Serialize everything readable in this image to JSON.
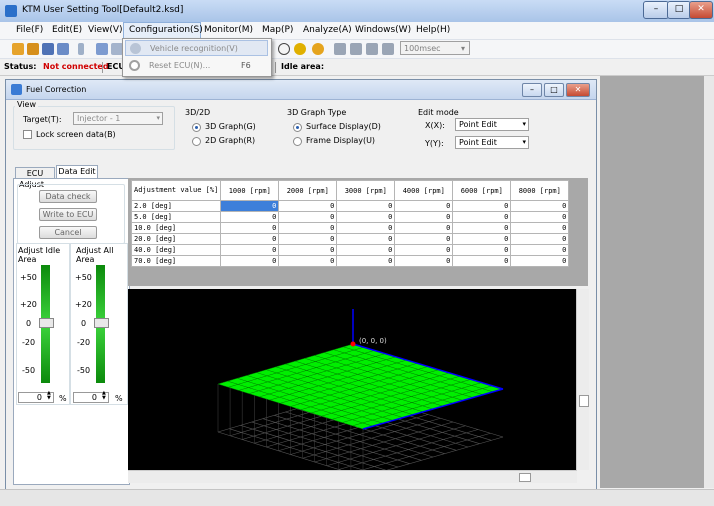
{
  "app": {
    "title": "KTM User Setting Tool[Default2.ksd]",
    "win_min": "–",
    "win_max": "□",
    "win_close": "✕"
  },
  "menu": {
    "file": "File(F)",
    "edit": "Edit(E)",
    "view": "View(V)",
    "configuration": "Configuration(S)",
    "monitor": "Monitor(M)",
    "map": "Map(P)",
    "analyze": "Analyze(A)",
    "windows": "Windows(W)",
    "help": "Help(H)"
  },
  "toolbar": {
    "interval": "100msec",
    "interval_arrow": "▾"
  },
  "dropdown": {
    "vehicle_recognition": "Vehicle recognition(V)",
    "reset_ecu": "Reset ECU(N)...",
    "reset_ecu_key": "F6"
  },
  "status": {
    "label": "Status:",
    "value": "Not connected",
    "ecu_prefix": "ECU",
    "idle_area": "Idle area:"
  },
  "fuel": {
    "title": "Fuel Correction",
    "view_group": "View",
    "target_label": "Target(T):",
    "target_value": "Injector - 1",
    "lock_label": "Lock screen data(B)",
    "group_3d2d": "3D/2D",
    "opt_3d": "3D Graph(G)",
    "opt_2d": "2D Graph(R)",
    "group_3dtype": "3D Graph Type",
    "opt_surface": "Surface Display(D)",
    "opt_frame": "Frame Display(U)",
    "group_edit": "Edit mode",
    "x_label": "X(X):",
    "x_value": "Point Edit",
    "y_label": "Y(Y):",
    "y_value": "Point Edit",
    "tab_ecu": "ECU Data",
    "tab_edit": "Data Edit",
    "adjust_group": "Adjust",
    "btn_check": "Data check",
    "btn_write": "Write to ECU",
    "btn_cancel": "Cancel",
    "adjust_idle": "Adjust Idle Area",
    "adjust_all": "Adjust All Area",
    "scale": [
      "+50",
      "+20",
      "0",
      "-20",
      "-50"
    ],
    "idle_value": "0",
    "all_value": "0",
    "unit": "%",
    "spin_up": "▲",
    "spin_down": "▼",
    "dropdown_arrow": "▾",
    "origin_label": "(0, 0, 0)"
  },
  "table": {
    "corner": "Adjustment value [%]",
    "columns": [
      "1000 [rpm]",
      "2000 [rpm]",
      "3000 [rpm]",
      "4000 [rpm]",
      "6000 [rpm]",
      "8000 [rpm]"
    ],
    "rows": [
      {
        "label": "2.0 [deg]",
        "values": [
          "0",
          "0",
          "0",
          "0",
          "0",
          "0"
        ]
      },
      {
        "label": "5.0 [deg]",
        "values": [
          "0",
          "0",
          "0",
          "0",
          "0",
          "0"
        ]
      },
      {
        "label": "10.0 [deg]",
        "values": [
          "0",
          "0",
          "0",
          "0",
          "0",
          "0"
        ]
      },
      {
        "label": "20.0 [deg]",
        "values": [
          "0",
          "0",
          "0",
          "0",
          "0",
          "0"
        ]
      },
      {
        "label": "40.0 [deg]",
        "values": [
          "0",
          "0",
          "0",
          "0",
          "0",
          "0"
        ]
      },
      {
        "label": "70.0 [deg]",
        "values": [
          "0",
          "0",
          "0",
          "0",
          "0",
          "0"
        ]
      }
    ]
  },
  "colors": {
    "surface": "#00ee00",
    "status_red": "#d00000",
    "selection": "#3d7fda",
    "axis_blue": "#0000ff"
  }
}
